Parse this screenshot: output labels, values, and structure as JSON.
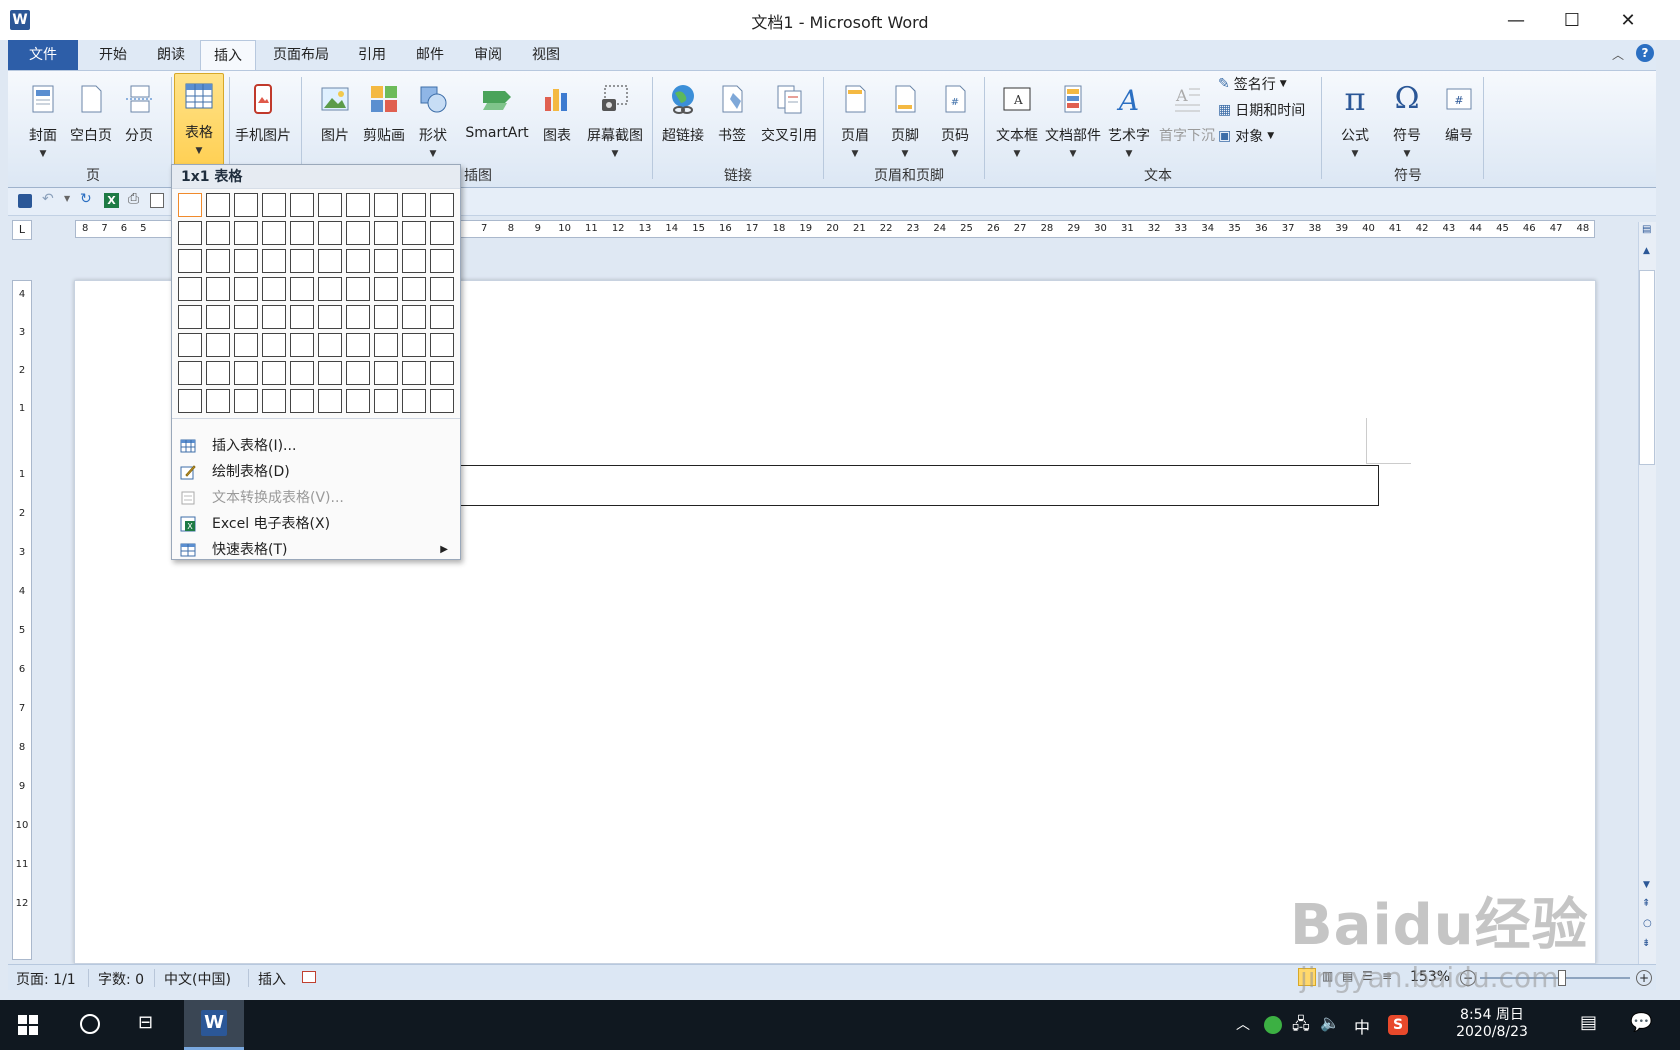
{
  "window": {
    "title": "文档1 - Microsoft Word",
    "app_icon": "W",
    "minimize": "—",
    "maximize": "☐",
    "close": "✕"
  },
  "tabs": [
    {
      "label": "文件"
    },
    {
      "label": "开始"
    },
    {
      "label": "朗读"
    },
    {
      "label": "插入"
    },
    {
      "label": "页面布局"
    },
    {
      "label": "引用"
    },
    {
      "label": "邮件"
    },
    {
      "label": "审阅"
    },
    {
      "label": "视图"
    }
  ],
  "ribbon": {
    "page_group": {
      "label": "页",
      "cover": "封面",
      "blank": "空白页",
      "break": "分页"
    },
    "table_group": {
      "table": "表格"
    },
    "phone_pic": "手机图片",
    "illustrations": {
      "label": "插图",
      "picture": "图片",
      "clipart": "剪贴画",
      "shapes": "形状",
      "smartart": "SmartArt",
      "chart": "图表",
      "screenshot": "屏幕截图"
    },
    "links": {
      "label": "链接",
      "hyperlink": "超链接",
      "bookmark": "书签",
      "crossref": "交叉引用"
    },
    "header_footer": {
      "label": "页眉和页脚",
      "header": "页眉",
      "footer": "页脚",
      "pagenum": "页码"
    },
    "text": {
      "label": "文本",
      "textbox": "文本框",
      "quickparts": "文档部件",
      "wordart": "艺术字",
      "dropcap": "首字下沉",
      "signature": "签名行",
      "datetime": "日期和时间",
      "object": "对象"
    },
    "symbols": {
      "label": "符号",
      "equation": "公式",
      "symbol": "符号",
      "number": "编号"
    }
  },
  "ruler": {
    "corner": "L",
    "h_left": [
      "8",
      "7",
      "6",
      "5"
    ],
    "h_right": [
      "6",
      "7",
      "8",
      "9",
      "10",
      "11",
      "12",
      "13",
      "14",
      "15",
      "16",
      "17",
      "18",
      "19",
      "20",
      "21",
      "22",
      "23",
      "24",
      "25",
      "26",
      "27",
      "28",
      "29",
      "30",
      "31",
      "32",
      "33",
      "34",
      "35",
      "36",
      "37",
      "38",
      "39",
      "40",
      "41",
      "42",
      "43",
      "44",
      "45",
      "46",
      "47",
      "48"
    ],
    "v_top": [
      "4",
      "3",
      "2",
      "1"
    ],
    "v_bottom": [
      "1",
      "2",
      "3",
      "4",
      "5",
      "6",
      "7",
      "8",
      "9",
      "10",
      "11",
      "12"
    ]
  },
  "table_menu": {
    "header": "1x1 表格",
    "grid_cols": 10,
    "grid_rows": 8,
    "items": [
      {
        "label": "插入表格(I)...",
        "icon": "table-icon",
        "disabled": false
      },
      {
        "label": "绘制表格(D)",
        "icon": "pencil-icon",
        "disabled": false
      },
      {
        "label": "文本转换成表格(V)...",
        "icon": "convert-icon",
        "disabled": true
      },
      {
        "label": "Excel 电子表格(X)",
        "icon": "excel-icon",
        "disabled": false
      },
      {
        "label": "快速表格(T)",
        "icon": "quick-table-icon",
        "disabled": false,
        "submenu": true
      }
    ]
  },
  "status": {
    "page": "页面: 1/1",
    "words": "字数: 0",
    "lang": "中文(中国)",
    "mode": "插入",
    "zoom": "153%"
  },
  "taskbar": {
    "time": "8:54 周日",
    "date": "2020/8/23",
    "ime": "中"
  },
  "watermark": {
    "brand": "Baidu经验",
    "url": "jingyan.baidu.com"
  },
  "colors": {
    "file_tab": "#2d5ea8",
    "highlight": "#ffcf52",
    "grid_selected": "#f08a2c"
  }
}
